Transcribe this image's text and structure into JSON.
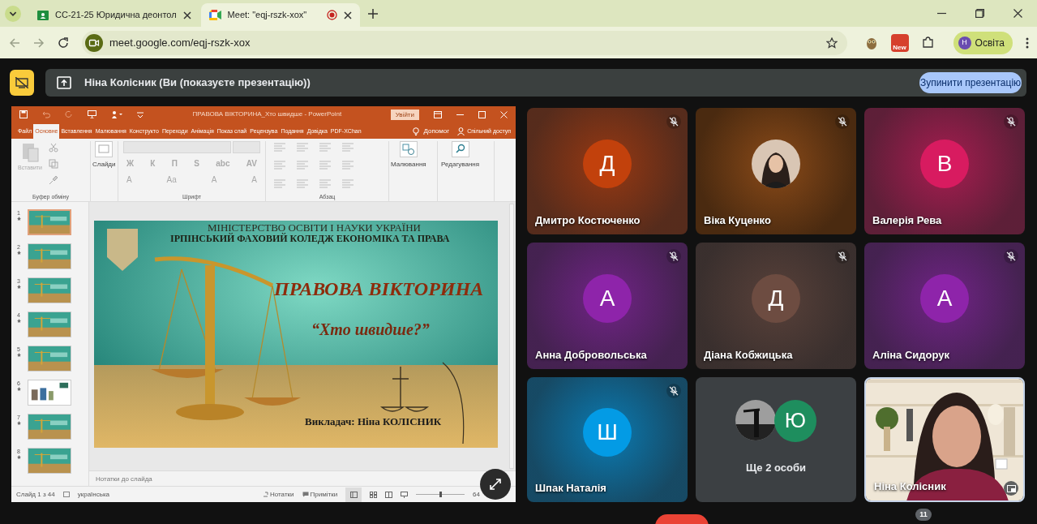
{
  "browser": {
    "tabs": [
      {
        "title": "СС-21-25 Юридична деонтол",
        "selected": false,
        "kind": "classroom"
      },
      {
        "title": "Meet: \"eqj-rszk-xox\"",
        "selected": true,
        "kind": "meet"
      }
    ],
    "url": "meet.google.com/eqj-rszk-xox",
    "extension_badge": "New",
    "profile": {
      "initial": "Н",
      "name": "Освіта"
    }
  },
  "presenting_bar": {
    "text": "Ніна Колісник (Ви (показуєте презентацію))",
    "stop_button": "Зупинити презентацію"
  },
  "powerpoint": {
    "title": "ПРАВОВА ВІКТОРИНА_Хто швидше  -  PowerPoint",
    "sign_in": "Увійти",
    "ribbon_tabs": [
      {
        "label": "Файл",
        "selected": false
      },
      {
        "label": "Основне",
        "selected": true
      },
      {
        "label": "Вставлення",
        "selected": false
      },
      {
        "label": "Малювання",
        "selected": false
      },
      {
        "label": "Конструкто",
        "selected": false
      },
      {
        "label": "Переходи",
        "selected": false
      },
      {
        "label": "Анімація",
        "selected": false
      },
      {
        "label": "Показ слай",
        "selected": false
      },
      {
        "label": "Рецензува",
        "selected": false
      },
      {
        "label": "Подання",
        "selected": false
      },
      {
        "label": "Довідка",
        "selected": false
      },
      {
        "label": "PDF-XChan",
        "selected": false
      }
    ],
    "help": "Допомог",
    "share": "Спільний доступ",
    "clipboard": {
      "label": "Буфер обміну",
      "paste": "Вставити"
    },
    "slides_button": "Слайди",
    "font": {
      "label": "Шрифт",
      "row_1": [
        "Ж",
        "К",
        "П",
        "S",
        "abc",
        "AV"
      ],
      "row_2": [
        "A",
        "Aa",
        "A",
        "A"
      ]
    },
    "paragraph": {
      "label": "Абзац"
    },
    "drawing_button": "Малювання",
    "editing_button": "Редагування",
    "thumbnails": [
      {
        "number": "1",
        "kind": "teal",
        "selected": true
      },
      {
        "number": "2",
        "kind": "teal",
        "selected": false
      },
      {
        "number": "3",
        "kind": "teal",
        "selected": false
      },
      {
        "number": "4",
        "kind": "teal",
        "selected": false
      },
      {
        "number": "5",
        "kind": "teal",
        "selected": false
      },
      {
        "number": "6",
        "kind": "white",
        "selected": false
      },
      {
        "number": "7",
        "kind": "teal",
        "selected": false
      },
      {
        "number": "8",
        "kind": "teal",
        "selected": false
      }
    ],
    "slide": {
      "ministry": "МІНІСТЕРСТВО ОСВІТИ І НАУКИ УКРАЇНИ",
      "college": "ІРПІНСЬКИЙ ФАХОВИЙ КОЛЕДЖ ЕКОНОМІКА ТА ПРАВА",
      "title": "ПРАВОВА ВІКТОРИНА",
      "subtitle": "“Хто швидше?”",
      "teacher": "Викладач: Ніна КОЛІСНИК"
    },
    "notes": "Нотатки до слайда",
    "status": {
      "slide": "Слайд 1 з 44",
      "language": "українська",
      "notes": "Нотатки",
      "comments": "Примітки",
      "zoom_slider": {
        "level": 0.5
      },
      "zoom": "64"
    }
  },
  "participants": [
    {
      "name": "Дмитро Костюченко",
      "kind": "avatar",
      "initial": "Д",
      "color": "#c2410c",
      "muted": true
    },
    {
      "name": "Віка Куценко",
      "muted": true
    },
    {
      "name": "Валерія Рева",
      "kind": "avatar",
      "initial": "В",
      "color": "#d81b60",
      "muted": true
    },
    {
      "name": "Анна Добровольська",
      "kind": "avatar",
      "initial": "А",
      "color": "#8e24aa",
      "muted": true
    },
    {
      "name": "Діана Кобжицька",
      "kind": "avatar",
      "initial": "Д",
      "color": "#6d4c41",
      "muted": true
    },
    {
      "name": "Аліна Сидорук",
      "kind": "avatar",
      "initial": "А",
      "color": "#8e24aa",
      "muted": true
    },
    {
      "name": "Шпак Наталія",
      "kind": "avatar",
      "initial": "Ш",
      "color": "#039be5",
      "muted": true
    },
    {
      "name": "Ще 2 особи",
      "kind": "group",
      "initial": "Ю",
      "color": "#1e8e5e",
      "muted": false
    },
    {
      "name": "Ніна Колісник",
      "kind": "video",
      "muted": false
    }
  ],
  "people_count": "11"
}
